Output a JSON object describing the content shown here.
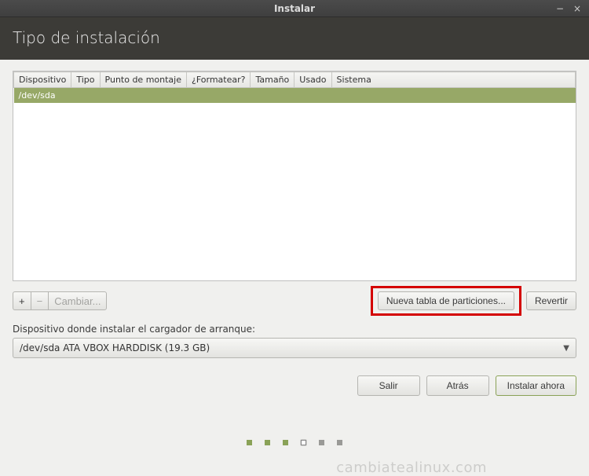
{
  "window": {
    "title": "Instalar"
  },
  "header": {
    "title": "Tipo de instalación"
  },
  "watermark": "cambiatealinux.com",
  "table": {
    "columns": [
      "Dispositivo",
      "Tipo",
      "Punto de montaje",
      "¿Formatear?",
      "Tamaño",
      "Usado",
      "Sistema"
    ],
    "row_device": "/dev/sda"
  },
  "toolbar": {
    "add": "+",
    "remove": "−",
    "change": "Cambiar...",
    "new_table": "Nueva tabla de particiones...",
    "revert": "Revertir"
  },
  "bootloader": {
    "label": "Dispositivo donde instalar el cargador de arranque:",
    "selected": "/dev/sda ATA VBOX HARDDISK (19.3 GB)"
  },
  "nav": {
    "quit": "Salir",
    "back": "Atrás",
    "install": "Instalar ahora"
  }
}
